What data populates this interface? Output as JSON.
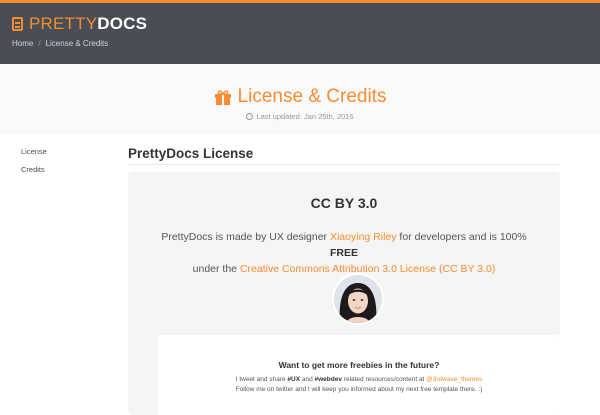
{
  "brand": {
    "light": "PRETTY",
    "bold": "DOCS"
  },
  "breadcrumb": {
    "home": "Home",
    "current": "License & Credits",
    "separator": "/"
  },
  "hero": {
    "title": "License & Credits",
    "updated": "Last updated: Jan 25th, 2016"
  },
  "sidebar": {
    "items": [
      {
        "label": "License"
      },
      {
        "label": "Credits"
      }
    ]
  },
  "section": {
    "title": "PrettyDocs License"
  },
  "card": {
    "heading": "CC BY 3.0",
    "text1": "PrettyDocs is made by UX designer ",
    "designer": "Xiaoying Riley",
    "text2": " for developers and is 100% ",
    "free": "FREE",
    "text3": " under the ",
    "license_link": "Creative Commons Attribution 3.0 License (CC BY 3.0)"
  },
  "promo": {
    "heading": "Want to get more freebies in the future?",
    "line1_a": "I tweet and share ",
    "tag_ux": "#UX",
    "line1_b": " and ",
    "tag_webdev": "#webdev",
    "line1_c": " related resources/content at ",
    "twitter": "@3rdwave_themes",
    "line2": "Follow me on twitter and I will keep you informed about my next free template there. :)"
  },
  "colors": {
    "accent": "#f88c30",
    "header_bg": "#494d55",
    "card_bg": "#f5f5f5"
  },
  "icons": {
    "brand": "document-icon",
    "title": "gift-icon",
    "updated": "clock-icon"
  }
}
